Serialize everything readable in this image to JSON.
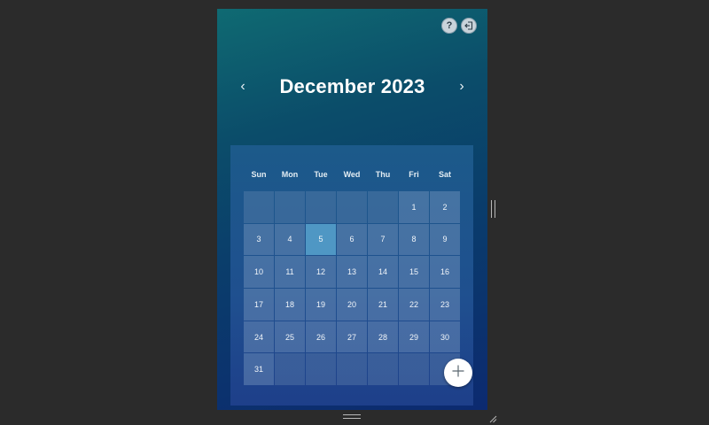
{
  "toolbar": {
    "help_label": "?",
    "help_icon": "help-icon",
    "exit_icon": "exit-icon"
  },
  "calendar": {
    "month_title": "December 2023",
    "prev_label": "‹",
    "next_label": "›",
    "weekdays": [
      "Sun",
      "Mon",
      "Tue",
      "Wed",
      "Thu",
      "Fri",
      "Sat"
    ],
    "days": [
      "",
      "",
      "",
      "",
      "",
      "1",
      "2",
      "3",
      "4",
      "5",
      "6",
      "7",
      "8",
      "9",
      "10",
      "11",
      "12",
      "13",
      "14",
      "15",
      "16",
      "17",
      "18",
      "19",
      "20",
      "21",
      "22",
      "23",
      "24",
      "25",
      "26",
      "27",
      "28",
      "29",
      "30",
      "31",
      "",
      "",
      "",
      "",
      "",
      ""
    ],
    "today": "5"
  },
  "fab": {
    "icon": "plus-icon"
  },
  "colors": {
    "background": "#2b2b2b",
    "today_highlight": "#4f97c4",
    "panel": "#1f4f8f"
  }
}
